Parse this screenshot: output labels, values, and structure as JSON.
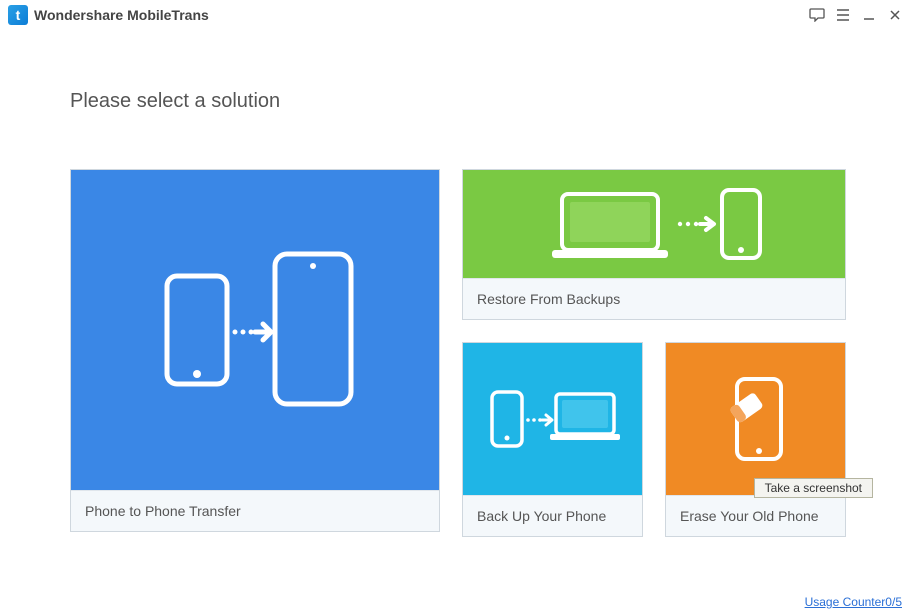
{
  "titlebar": {
    "logo_letter": "t",
    "title": "Wondershare MobileTrans"
  },
  "heading": "Please select a solution",
  "cards": {
    "p2p": {
      "label": "Phone to Phone Transfer"
    },
    "restore": {
      "label": "Restore From Backups"
    },
    "backup": {
      "label": "Back Up Your Phone"
    },
    "erase": {
      "label": "Erase Your Old Phone"
    }
  },
  "tooltip": "Take a screenshot",
  "footer": {
    "usage_counter": "Usage Counter0/5"
  }
}
